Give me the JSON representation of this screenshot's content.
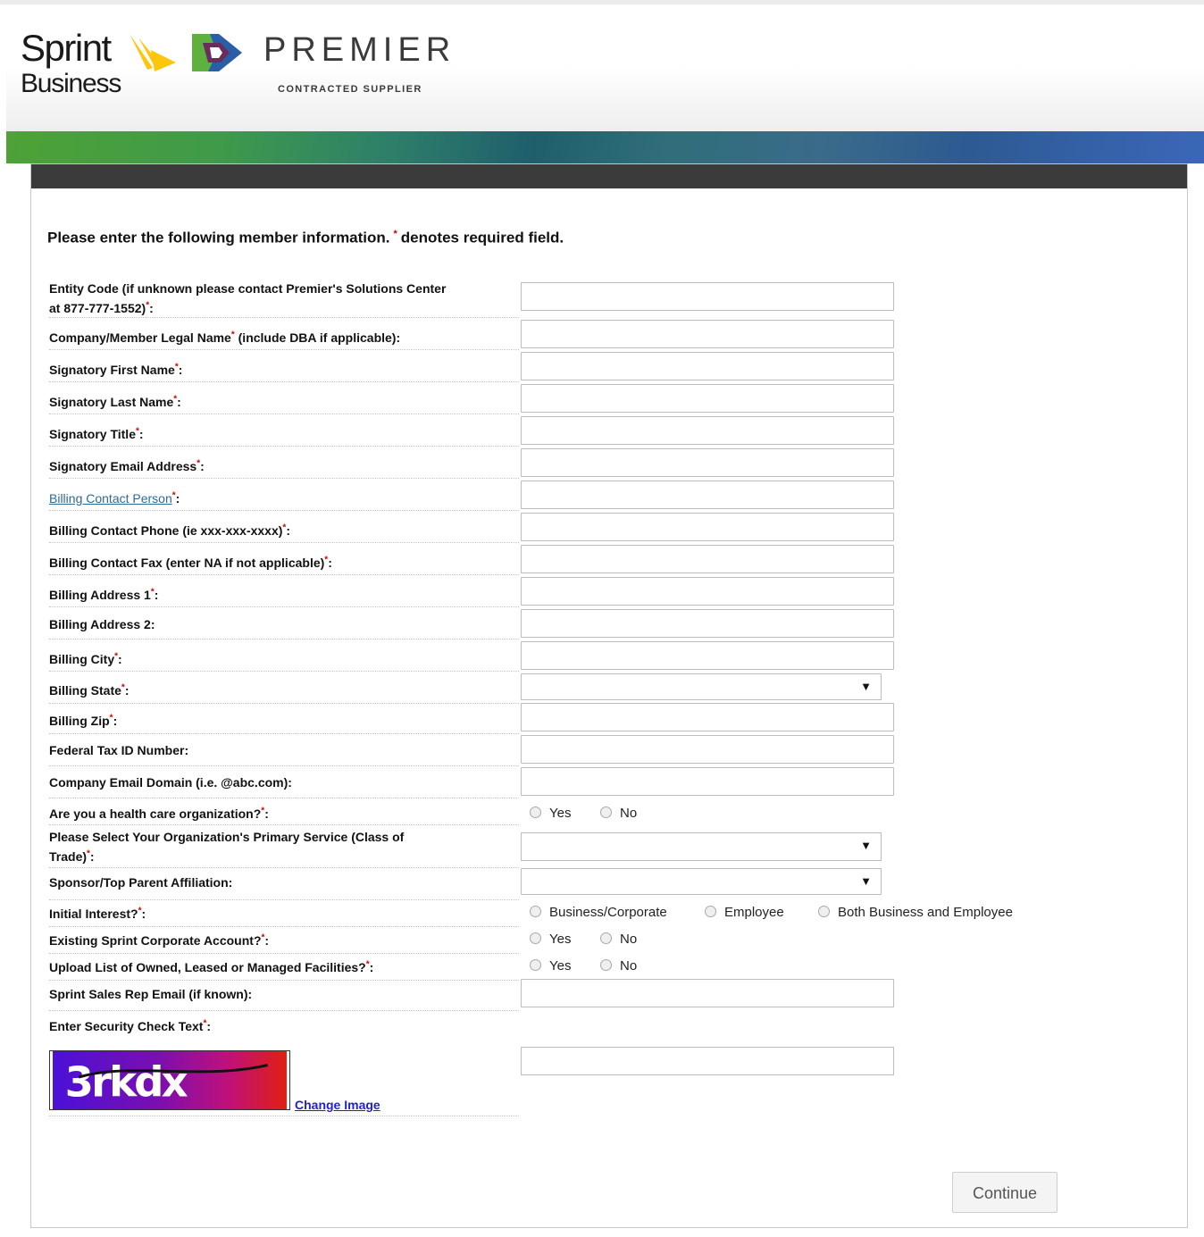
{
  "header": {
    "sprint_word": "Sprint",
    "business_word": "Business",
    "premier_word": "PREMIER",
    "premier_sub": "CONTRACTED SUPPLIER"
  },
  "colors": {
    "sprint_yellow": "#fcc70a",
    "premier_green": "#5fb13f",
    "premier_blue": "#2a5fa8",
    "premier_purple": "#6b2d5c",
    "required_star": "#cc0000",
    "link_blue": "#2d6a96"
  },
  "intro": {
    "before": "Please enter the following member information.",
    "star": "*",
    "after": "denotes required field."
  },
  "form": {
    "entity_code_1": "Entity Code (if unknown please contact Premier's Solutions Center",
    "entity_code_2": "at 877-777-1552)",
    "company_name_a": "Company/Member Legal Name",
    "company_name_b": " (include DBA if applicable):",
    "signatory_first": "Signatory First Name",
    "signatory_last": "Signatory Last Name",
    "signatory_title": "Signatory Title",
    "signatory_email": "Signatory Email Address",
    "billing_contact_person": "Billing Contact Person",
    "billing_contact_phone": "Billing Contact Phone (ie xxx-xxx-xxxx)",
    "billing_contact_fax": "Billing Contact Fax (enter NA if not applicable)",
    "billing_address_1": "Billing Address 1",
    "billing_address_2": "Billing Address 2:",
    "billing_city": "Billing City",
    "billing_state": "Billing State",
    "billing_zip": "Billing Zip",
    "federal_tax_id": "Federal Tax ID Number:",
    "company_email_domain": "Company Email Domain (i.e. @abc.com):",
    "health_care": "Are you a health care organization?",
    "primary_service_1": "Please Select Your Organization's Primary Service (Class of",
    "primary_service_2": "Trade)",
    "sponsor": "Sponsor/Top Parent Affiliation:",
    "initial_interest": "Initial Interest?",
    "existing_account": "Existing Sprint Corporate Account?",
    "upload_list": "Upload List of Owned, Leased or Managed Facilities?",
    "sales_rep_email": "Sprint Sales Rep Email (if known):",
    "security_check": "Enter Security Check Text",
    "req_star": "*",
    "colon": ":"
  },
  "options": {
    "yes": "Yes",
    "no": "No",
    "business_corporate": "Business/Corporate",
    "employee": "Employee",
    "both": "Both Business and Employee"
  },
  "captcha": {
    "text": "3rkdx",
    "change_image": "Change Image"
  },
  "buttons": {
    "continue": "Continue"
  },
  "select_arrow": "▼"
}
